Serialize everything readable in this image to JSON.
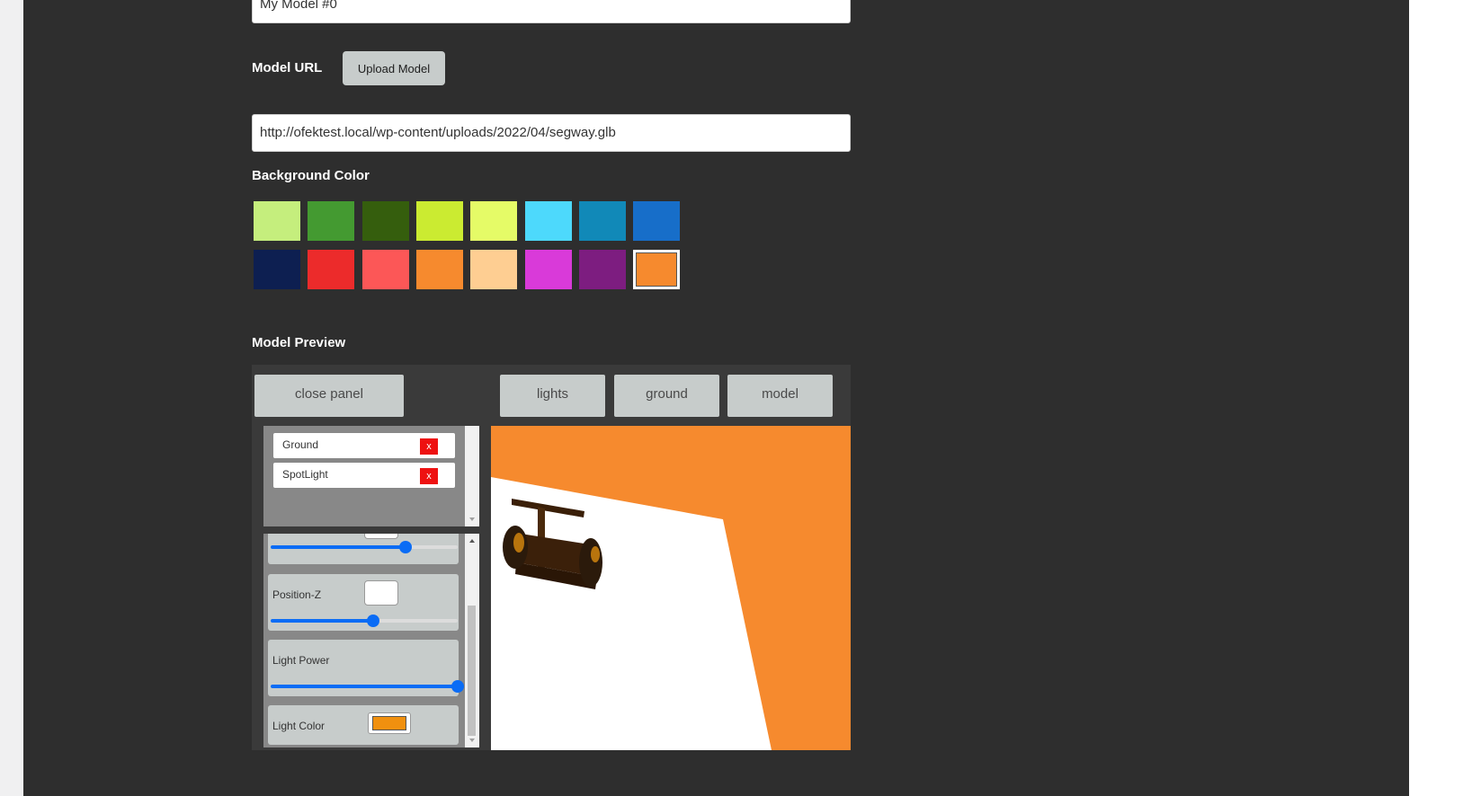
{
  "model_name": {
    "value": "My Model #0"
  },
  "model_url": {
    "label": "Model URL",
    "upload_button": "Upload Model",
    "value": "http://ofektest.local/wp-content/uploads/2022/04/segway.glb"
  },
  "background_color": {
    "label": "Background Color",
    "swatches": [
      "#c5ee7d",
      "#449a31",
      "#355e0d",
      "#cbeb31",
      "#e5fb67",
      "#4dd9fc",
      "#1189b8",
      "#176ec9",
      "#0d1f51",
      "#ec2b2b",
      "#fc5757",
      "#f68a2e",
      "#fece92",
      "#d93ad9",
      "#7d1d80",
      "#f68a2e"
    ],
    "selected_index": 15
  },
  "model_preview": {
    "label": "Model Preview",
    "close_panel": "close panel",
    "tabs": [
      "lights",
      "ground",
      "model"
    ],
    "objects": [
      {
        "name": "Ground",
        "delete": "x"
      },
      {
        "name": "SpotLight",
        "delete": "x"
      }
    ],
    "controls": {
      "position_y_level": 0.72,
      "position_z_label": "Position-Z",
      "position_z_level": 0.55,
      "light_power_label": "Light Power",
      "light_power_level": 1.0,
      "light_color_label": "Light Color",
      "light_color_value": "#f0900f"
    },
    "viewport_background": "#f68a2e"
  }
}
